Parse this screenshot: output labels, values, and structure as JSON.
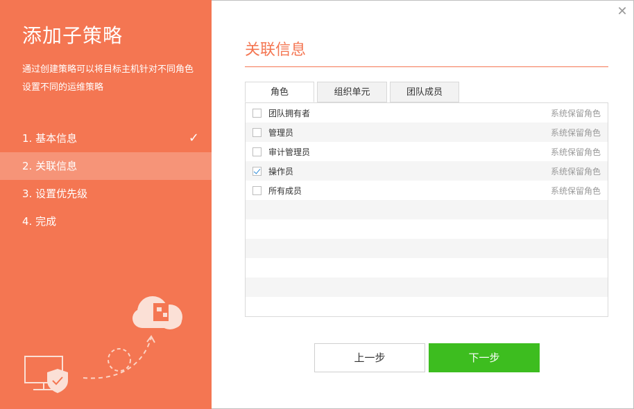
{
  "sidebar": {
    "title": "添加子策略",
    "description": "通过创建策略可以将目标主机针对不同角色设置不同的运维策略",
    "steps": [
      {
        "label": "1. 基本信息",
        "done": true
      },
      {
        "label": "2. 关联信息",
        "active": true
      },
      {
        "label": "3. 设置优先级"
      },
      {
        "label": "4. 完成"
      }
    ],
    "check_glyph": "✓"
  },
  "main": {
    "close_glyph": "✕",
    "section_title": "关联信息",
    "tabs": [
      {
        "label": "角色",
        "active": true
      },
      {
        "label": "组织单元"
      },
      {
        "label": "团队成员"
      }
    ],
    "rows": [
      {
        "name": "团队拥有者",
        "tag": "系统保留角色",
        "checked": false
      },
      {
        "name": "管理员",
        "tag": "系统保留角色",
        "checked": false
      },
      {
        "name": "审计管理员",
        "tag": "系统保留角色",
        "checked": false
      },
      {
        "name": "操作员",
        "tag": "系统保留角色",
        "checked": true
      },
      {
        "name": "所有成员",
        "tag": "系统保留角色",
        "checked": false
      }
    ],
    "empty_rows": 6
  },
  "buttons": {
    "prev": "上一步",
    "next": "下一步"
  },
  "colors": {
    "accent": "#f47652",
    "primary_button": "#3dbd1f"
  }
}
